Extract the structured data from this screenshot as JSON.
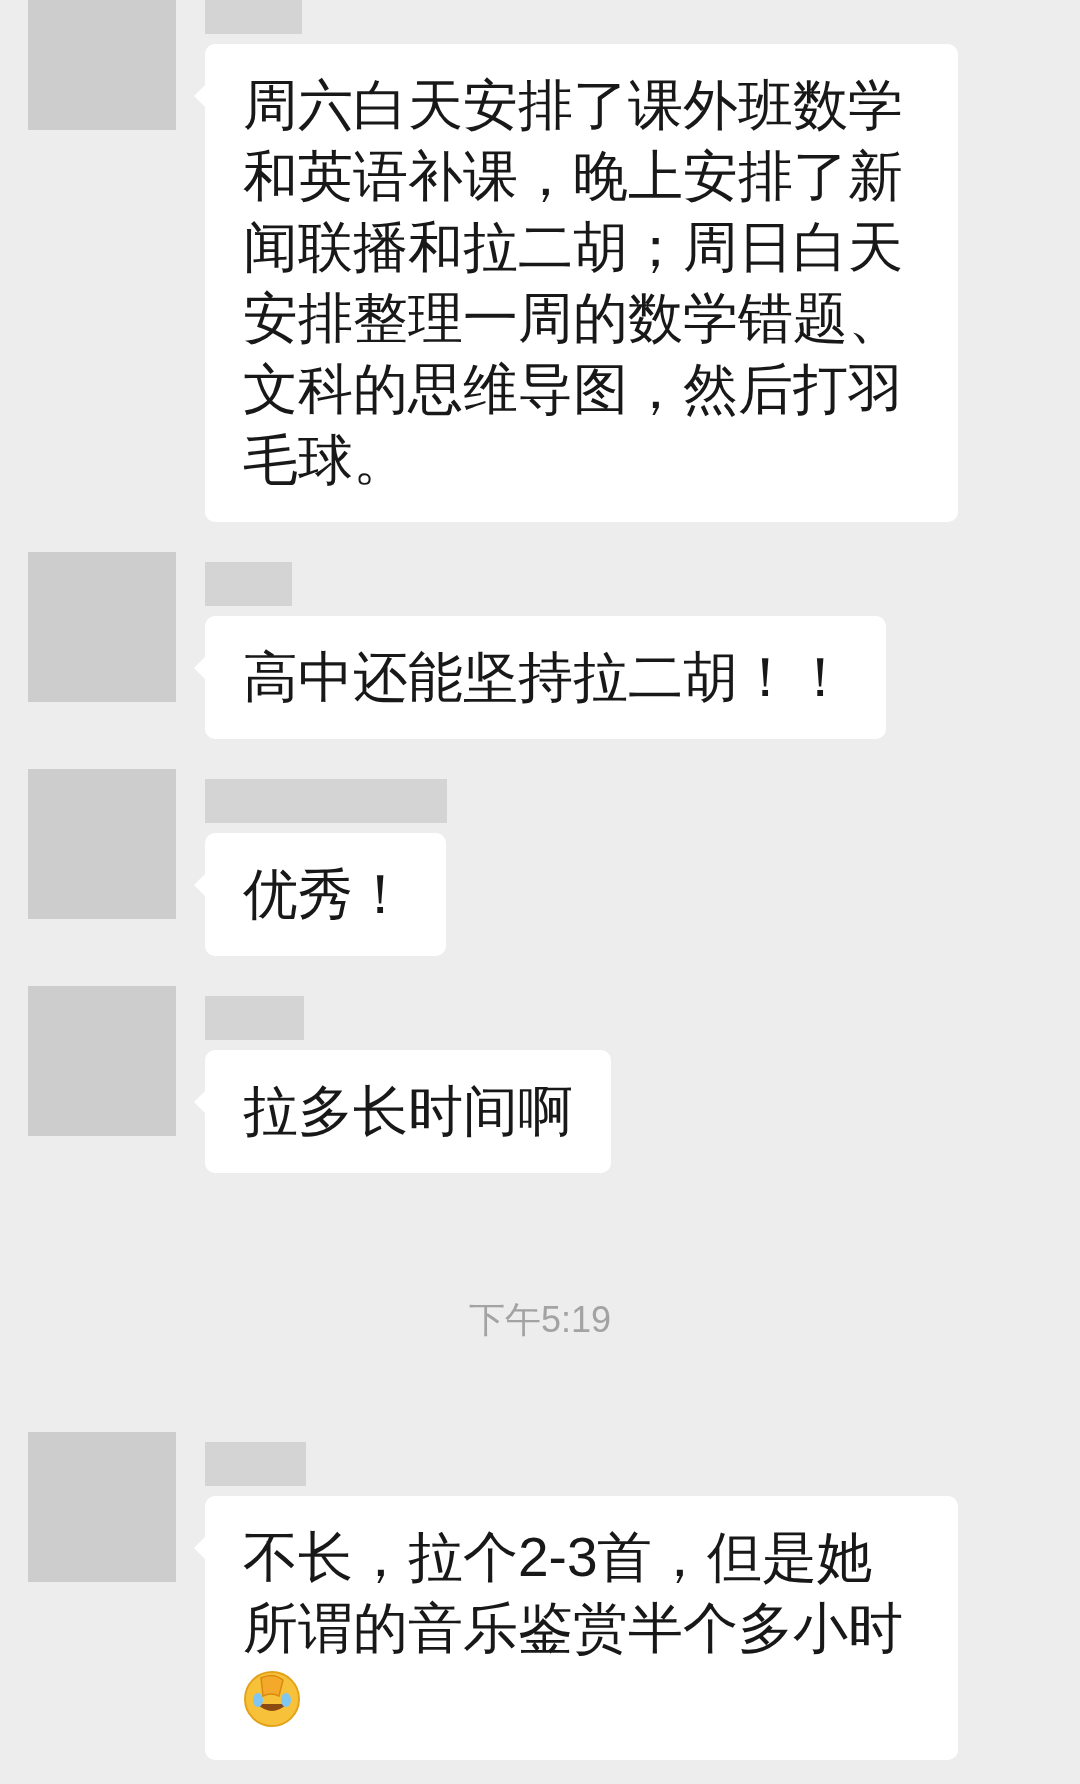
{
  "messages": [
    {
      "kind": "received",
      "text": "周六白天安排了课外班数学和英语补课，晚上安排了新闻联播和拉二胡；周日白天安排整理一周的数学错题、文科的思维导图，然后打羽毛球。"
    },
    {
      "kind": "received",
      "text": "高中还能坚持拉二胡！！"
    },
    {
      "kind": "received",
      "text": "优秀！"
    },
    {
      "kind": "received",
      "text": "拉多长时间啊"
    },
    {
      "kind": "time",
      "text": "下午5:19"
    },
    {
      "kind": "received_with_emoji",
      "text": "不长，拉个2-3首，但是她所谓的音乐鉴赏半个多小时"
    }
  ]
}
